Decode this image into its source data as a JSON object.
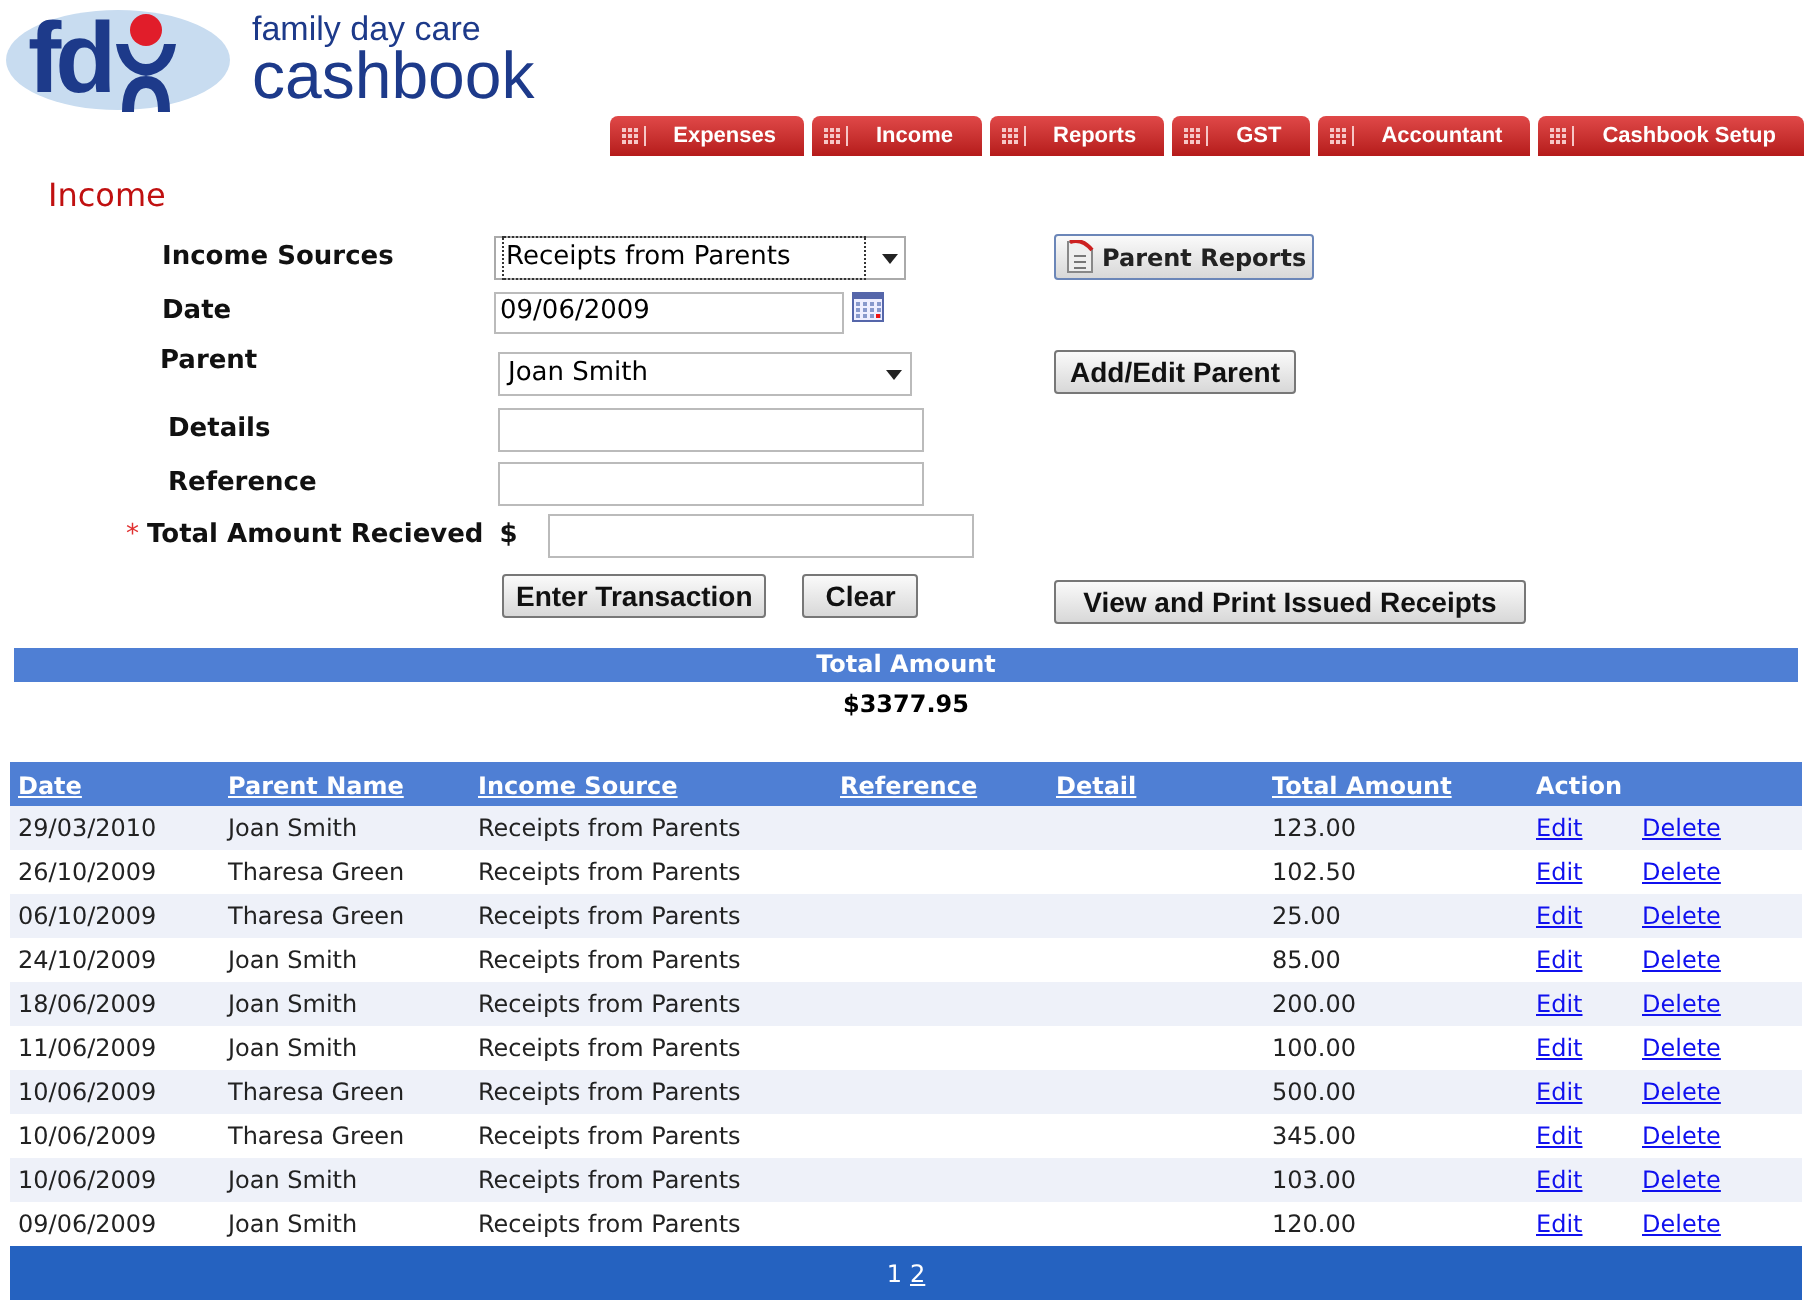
{
  "logo": {
    "mark": "fd",
    "tagline": "family day care",
    "product": "cashbook"
  },
  "tabs": [
    "Expenses",
    "Income",
    "Reports",
    "GST",
    "Accountant",
    "Cashbook Setup"
  ],
  "page_title": "Income",
  "form": {
    "income_sources": {
      "label": "Income Sources",
      "value": "Receipts from Parents"
    },
    "date": {
      "label": "Date",
      "value": "09/06/2009"
    },
    "parent": {
      "label": "Parent",
      "value": "Joan Smith"
    },
    "details": {
      "label": "Details"
    },
    "reference": {
      "label": "Reference"
    },
    "total": {
      "required_mark": "*",
      "label": "Total Amount Recieved",
      "currency": "$"
    },
    "buttons": [
      "Enter Transaction",
      "Clear"
    ],
    "side_buttons": [
      "Parent Reports",
      "Add/Edit Parent",
      "View and Print Issued Receipts"
    ]
  },
  "total_amount": {
    "label": "Total Amount",
    "value": "$3377.95"
  },
  "table": {
    "columns": [
      {
        "label": "Date",
        "sortable": true
      },
      {
        "label": "Parent Name",
        "sortable": true
      },
      {
        "label": "Income Source",
        "sortable": true
      },
      {
        "label": "Reference",
        "sortable": true
      },
      {
        "label": "Detail",
        "sortable": true
      },
      {
        "label": "Total Amount",
        "sortable": true
      },
      {
        "label": "Action",
        "sortable": false
      }
    ],
    "rows": [
      {
        "date": "29/03/2010",
        "parent": "Joan Smith",
        "source": "Receipts from Parents",
        "amount": "123.00",
        "edit": "Edit",
        "delete": "Delete"
      },
      {
        "date": "26/10/2009",
        "parent": "Tharesa Green",
        "source": "Receipts from Parents",
        "amount": "102.50",
        "edit": "Edit",
        "delete": "Delete"
      },
      {
        "date": "06/10/2009",
        "parent": "Tharesa Green",
        "source": "Receipts from Parents",
        "amount": "25.00",
        "edit": "Edit",
        "delete": "Delete"
      },
      {
        "date": "24/10/2009",
        "parent": "Joan Smith",
        "source": "Receipts from Parents",
        "amount": "85.00",
        "edit": "Edit",
        "delete": "Delete"
      },
      {
        "date": "18/06/2009",
        "parent": "Joan Smith",
        "source": "Receipts from Parents",
        "amount": "200.00",
        "edit": "Edit",
        "delete": "Delete"
      },
      {
        "date": "11/06/2009",
        "parent": "Joan Smith",
        "source": "Receipts from Parents",
        "amount": "100.00",
        "edit": "Edit",
        "delete": "Delete"
      },
      {
        "date": "10/06/2009",
        "parent": "Tharesa Green",
        "source": "Receipts from Parents",
        "amount": "500.00",
        "edit": "Edit",
        "delete": "Delete"
      },
      {
        "date": "10/06/2009",
        "parent": "Tharesa Green",
        "source": "Receipts from Parents",
        "amount": "345.00",
        "edit": "Edit",
        "delete": "Delete"
      },
      {
        "date": "10/06/2009",
        "parent": "Joan Smith",
        "source": "Receipts from Parents",
        "amount": "103.00",
        "edit": "Edit",
        "delete": "Delete"
      },
      {
        "date": "09/06/2009",
        "parent": "Joan Smith",
        "source": "Receipts from Parents",
        "amount": "120.00",
        "edit": "Edit",
        "delete": "Delete"
      }
    ]
  },
  "pages": [
    {
      "label": "1",
      "selected": true
    },
    {
      "label": "2",
      "selected": false
    }
  ]
}
